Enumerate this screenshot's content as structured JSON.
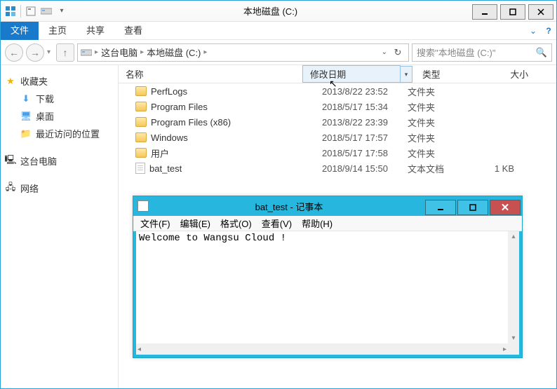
{
  "explorer": {
    "title": "本地磁盘 (C:)",
    "ribbon": {
      "file": "文件",
      "home": "主页",
      "share": "共享",
      "view": "查看"
    },
    "breadcrumb": {
      "root": "这台电脑",
      "drive": "本地磁盘 (C:)"
    },
    "search_placeholder": "搜索\"本地磁盘 (C:)\"",
    "nav": {
      "favorites": "收藏夹",
      "downloads": "下载",
      "desktop": "桌面",
      "recent": "最近访问的位置",
      "this_pc": "这台电脑",
      "network": "网络"
    },
    "columns": {
      "name": "名称",
      "date": "修改日期",
      "type": "类型",
      "size": "大小"
    },
    "rows": [
      {
        "icon": "folder",
        "name": "PerfLogs",
        "date": "2013/8/22 23:52",
        "type": "文件夹",
        "size": ""
      },
      {
        "icon": "folder",
        "name": "Program Files",
        "date": "2018/5/17 15:34",
        "type": "文件夹",
        "size": ""
      },
      {
        "icon": "folder",
        "name": "Program Files (x86)",
        "date": "2013/8/22 23:39",
        "type": "文件夹",
        "size": ""
      },
      {
        "icon": "folder",
        "name": "Windows",
        "date": "2018/5/17 17:57",
        "type": "文件夹",
        "size": ""
      },
      {
        "icon": "folder",
        "name": "用户",
        "date": "2018/5/17 17:58",
        "type": "文件夹",
        "size": ""
      },
      {
        "icon": "file",
        "name": "bat_test",
        "date": "2018/9/14 15:50",
        "type": "文本文档",
        "size": "1 KB"
      }
    ]
  },
  "notepad": {
    "title": "bat_test - 记事本",
    "menu": {
      "file": "文件(F)",
      "edit": "编辑(E)",
      "format": "格式(O)",
      "view": "查看(V)",
      "help": "帮助(H)"
    },
    "content": "Welcome to Wangsu Cloud !"
  }
}
